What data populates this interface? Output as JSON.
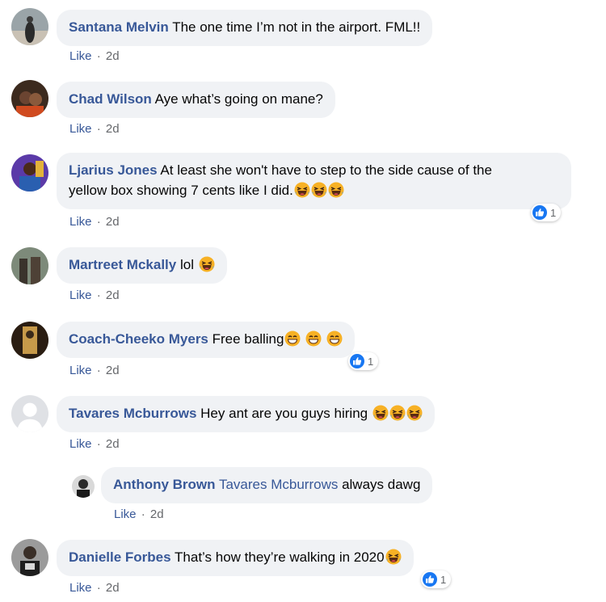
{
  "comments": [
    {
      "author": "Santana Melvin",
      "text": "The one time I’m not in the airport. FML!!",
      "like_label": "Like",
      "time": "2d"
    },
    {
      "author": "Chad Wilson",
      "text": "Aye what’s going on mane?",
      "like_label": "Like",
      "time": "2d"
    },
    {
      "author": "Ljarius Jones",
      "text_line1": "At least she won't have to step to the side cause of the",
      "text_line2": "yellow box showing 7 cents like I did.",
      "like_label": "Like",
      "time": "2d",
      "reaction_count": "1"
    },
    {
      "author": "Martreet Mckally",
      "text": "lol",
      "like_label": "Like",
      "time": "2d"
    },
    {
      "author": "Coach-Cheeko Myers",
      "text": "Free balling",
      "like_label": "Like",
      "time": "2d",
      "reaction_count": "1"
    },
    {
      "author": "Tavares Mcburrows",
      "text": "Hey ant are you guys hiring",
      "like_label": "Like",
      "time": "2d"
    },
    {
      "author": "Anthony Brown",
      "mention": "Tavares Mcburrows",
      "text": "always dawg",
      "like_label": "Like",
      "time": "2d",
      "is_reply": true
    },
    {
      "author": "Danielle Forbes",
      "text": "That’s how they’re walking in 2020",
      "like_label": "Like",
      "time": "2d",
      "reaction_count": "1"
    }
  ],
  "colors": {
    "author": "#385898",
    "bubble": "#f0f2f5",
    "meta": "#65676b",
    "like_reaction": "#1877f2"
  }
}
